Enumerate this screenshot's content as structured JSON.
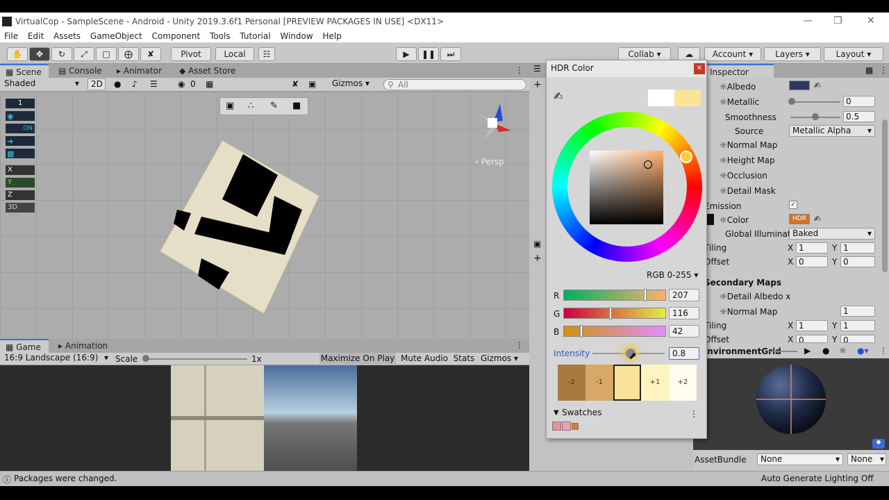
{
  "window": {
    "title": "VirtualCop - SampleScene - Android - Unity 2019.3.6f1 Personal [PREVIEW PACKAGES IN USE] <DX11>"
  },
  "menu": [
    "File",
    "Edit",
    "Assets",
    "GameObject",
    "Component",
    "Tools",
    "Tutorial",
    "Window",
    "Help"
  ],
  "toolbar": {
    "pivot": "Pivot",
    "local": "Local",
    "collab": "Collab",
    "account": "Account",
    "layers": "Layers",
    "layout": "Layout"
  },
  "scene": {
    "tabs": [
      "Scene",
      "Console",
      "Animator",
      "Asset Store"
    ],
    "shading": "Shaded",
    "mode2d": "2D",
    "hidden_count": "0",
    "gizmos": "Gizmos",
    "search_placeholder": "All",
    "persp": "Persp",
    "layer_buttons": [
      "1",
      "ON",
      "X",
      "Y",
      "Z",
      "3D"
    ]
  },
  "game": {
    "tabs": [
      "Game",
      "Animation"
    ],
    "aspect": "16:9 Landscape (16:9)",
    "scale_label": "Scale",
    "scale_value": "1x",
    "maximize": "Maximize On Play",
    "mute": "Mute Audio",
    "stats": "Stats",
    "gizmos": "Gizmos"
  },
  "status": {
    "message": "Packages were changed.",
    "lighting": "Auto Generate Lighting Off"
  },
  "inspector": {
    "tab": "Inspector",
    "albedo": "Albedo",
    "metallic": "Metallic",
    "metallic_value": "0",
    "smoothness": "Smoothness",
    "smoothness_value": "0.5",
    "source": "Source",
    "source_value": "Metallic Alpha",
    "normal_map": "Normal Map",
    "height_map": "Height Map",
    "occlusion": "Occlusion",
    "detail_mask": "Detail Mask",
    "emission": "Emission",
    "color": "Color",
    "hdr": "HDR",
    "global_illum": "Global Illuminat",
    "global_illum_value": "Baked",
    "tiling": "Tiling",
    "offset": "Offset",
    "x": "X",
    "y": "Y",
    "tiling_x": "1",
    "tiling_y": "1",
    "offset_x": "0",
    "offset_y": "0",
    "secondary": "Secondary Maps",
    "detail_albedo": "Detail Albedo x",
    "normal_map2": "Normal Map",
    "normal_map2_value": "1",
    "tiling2_x": "1",
    "tiling2_y": "1",
    "offset2_x": "0",
    "offset2_y": "0",
    "preview_name": "EnvironmentGrid",
    "assetbundle": "AssetBundle",
    "assetbundle_value": "None",
    "assetbundle_variant": "None",
    "colors": {
      "albedo": "#2e3a5c",
      "emission": "#cf742a"
    }
  },
  "picker": {
    "title": "HDR Color",
    "mode": "RGB 0-255",
    "r_label": "R",
    "r_value": "207",
    "g_label": "G",
    "g_value": "116",
    "b_label": "B",
    "b_value": "42",
    "intensity_label": "Intensity",
    "intensity_value": "0.8",
    "stops": [
      "-2",
      "-1",
      "",
      "+1",
      "+2"
    ],
    "swatches_label": "Swatches",
    "preview_colors": {
      "old": "#ffffff",
      "new": "#fbe49a"
    }
  }
}
